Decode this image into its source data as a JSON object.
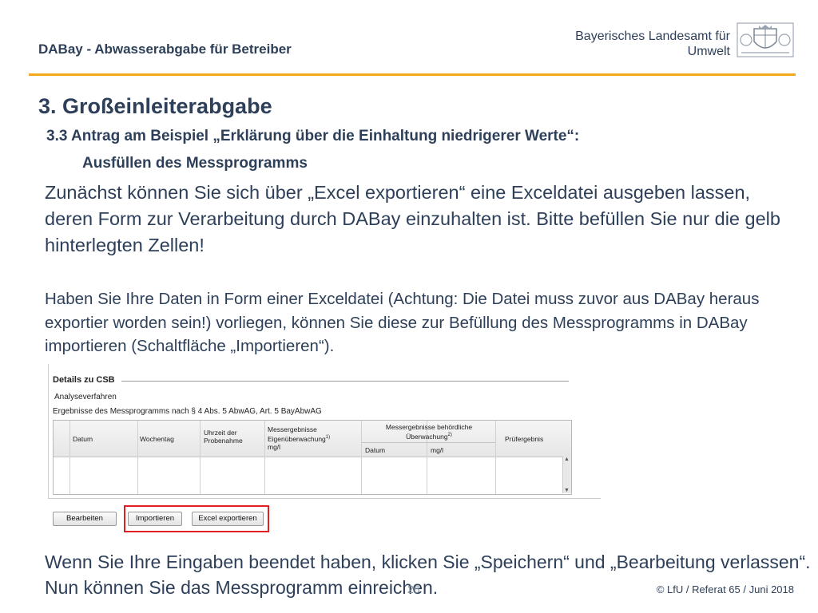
{
  "header": {
    "title": "DABay - Abwasserabgabe für Betreiber",
    "org_line1": "Bayerisches Landesamt für",
    "org_line2": "Umwelt"
  },
  "colors": {
    "accent_rule": "#f2a91c",
    "text": "#2e4059",
    "highlight": "#e02020"
  },
  "section_title": "3. Großeinleiterabgabe",
  "subtitle_line1": "3.3 Antrag am Beispiel „Erklärung über die Einhaltung niedrigerer Werte“:",
  "subtitle_line2": "Ausfüllen des Messprogramms",
  "paragraph1": "Zunächst können Sie sich über „Excel exportieren“ eine Exceldatei ausgeben lassen, deren Form zur Verarbeitung durch DABay einzuhalten ist. Bitte befüllen Sie nur die gelb hinterlegten Zellen!",
  "paragraph2": "Haben Sie Ihre Daten in Form einer Exceldatei (Achtung: Die Datei muss zuvor aus DABay heraus exportier worden sein!) vorliegen, können Sie diese zur Befüllung des Messprogramms in DABay importieren (Schaltfläche „Importieren“).",
  "embed": {
    "title": "Details zu CSB",
    "sub1": "Analyseverfahren",
    "sub2": "Ergebnisse des Messprogramms nach § 4 Abs. 5 AbwAG, Art. 5 BayAbwAG",
    "headers": {
      "datum": "Datum",
      "wochentag": "Wochentag",
      "uhrzeit": "Uhrzeit der Probenahme",
      "eigen_line1": "Messergebnisse",
      "eigen_line2": "Eigenüberwachung",
      "eigen_sup": "1)",
      "eigen_unit": "mg/l",
      "behoerd_line1": "Messergebnisse behördliche",
      "behoerd_line2": "Überwachung",
      "behoerd_sup": "2)",
      "behoerd_datum": "Datum",
      "behoerd_unit": "mg/l",
      "pruefergebnis": "Prüfergebnis"
    },
    "buttons": {
      "bearbeiten": "Bearbeiten",
      "importieren": "Importieren",
      "excel": "Excel exportieren"
    }
  },
  "paragraph3": "Wenn Sie Ihre Eingaben beendet haben, klicken Sie „Speichern“ und „Bearbeitung verlassen“. Nun können Sie das Messprogramm einreichen.",
  "slide_number": "26",
  "footer": "© LfU / Referat 65 / Juni 2018"
}
